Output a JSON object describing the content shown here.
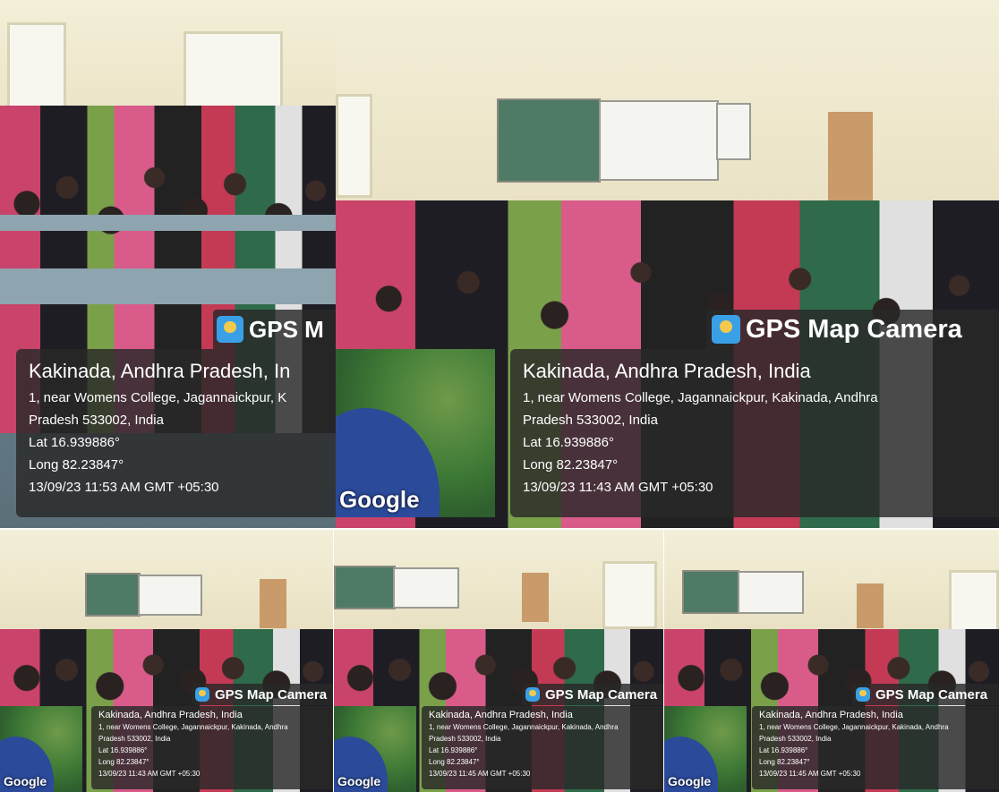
{
  "overlays": [
    {
      "brand": "GPS M",
      "place": "Kakinada, Andhra Pradesh, In",
      "addr1": "1, near Womens College, Jagannaickpur, K",
      "addr2": "Pradesh 533002, India",
      "lat": "Lat 16.939886°",
      "long": "Long 82.23847°",
      "time": "13/09/23 11:53 AM GMT +05:30"
    },
    {
      "brand": "GPS Map Camera",
      "place": "Kakinada, Andhra Pradesh, India",
      "addr1": "1, near Womens College, Jagannaickpur, Kakinada, Andhra",
      "addr2": "Pradesh 533002, India",
      "lat": "Lat 16.939886°",
      "long": "Long 82.23847°",
      "time": "13/09/23 11:43 AM GMT +05:30"
    },
    {
      "brand": "GPS Map Camera",
      "place": "Kakinada, Andhra Pradesh, India",
      "addr1": "1, near Womens College, Jagannaickpur, Kakinada, Andhra",
      "addr2": "Pradesh 533002, India",
      "lat": "Lat 16.939886°",
      "long": "Long 82.23847°",
      "time": "13/09/23 11:43 AM GMT +05:30"
    },
    {
      "brand": "GPS Map Camera",
      "place": "Kakinada, Andhra Pradesh, India",
      "addr1": "1, near Womens College, Jagannaickpur, Kakinada, Andhra",
      "addr2": "Pradesh 533002, India",
      "lat": "Lat 16.939886°",
      "long": "Long 82.23847°",
      "time": "13/09/23 11:45 AM GMT +05:30"
    },
    {
      "brand": "GPS Map Camera",
      "place": "Kakinada, Andhra Pradesh, India",
      "addr1": "1, near Womens College, Jagannaickpur, Kakinada, Andhra",
      "addr2": "Pradesh 533002, India",
      "lat": "Lat 16.939886°",
      "long": "Long 82.23847°",
      "time": "13/09/23 11:45 AM GMT +05:30"
    }
  ],
  "map_label": "Google"
}
